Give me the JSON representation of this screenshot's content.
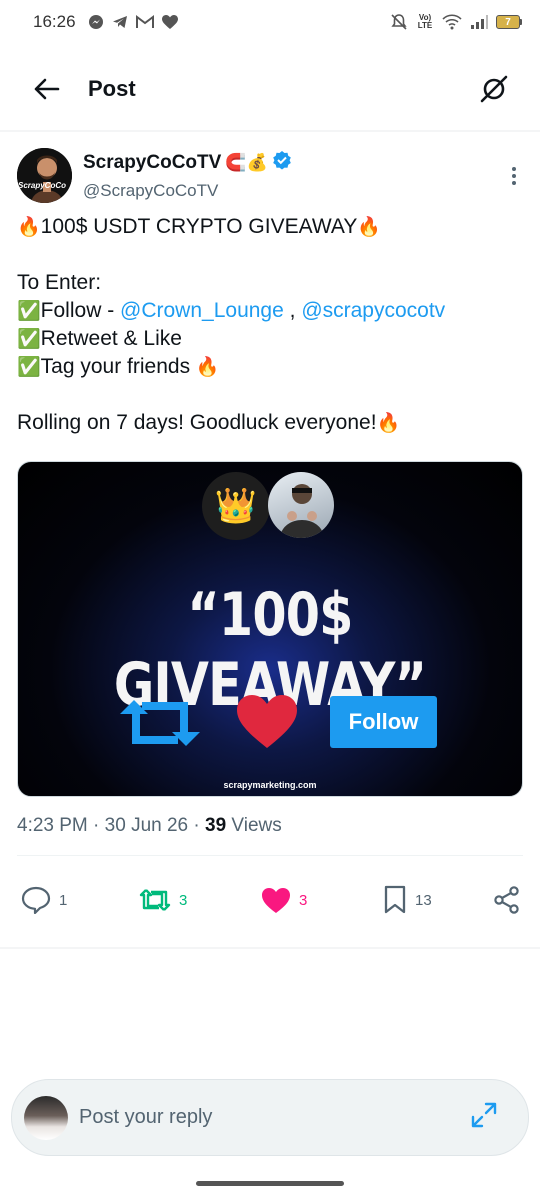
{
  "status_bar": {
    "time": "16:26",
    "network_label": "Vo) LTE",
    "battery_level": "7"
  },
  "header": {
    "title": "Post"
  },
  "author": {
    "name": "ScrapyCoCoTV",
    "name_emojis": "🧲💰",
    "handle": "@ScrapyCoCoTV",
    "avatar_text": "ScrapyCoCo"
  },
  "tweet": {
    "headline_prefix": "🔥",
    "headline": "100$ USDT CRYPTO GIVEAWAY",
    "headline_suffix": "🔥",
    "to_enter": "To Enter:",
    "step1_icon": "✅",
    "step1_text": "Follow - ",
    "mention1": "@Crown_Lounge",
    "separator": " , ",
    "mention2": "@scrapycocotv",
    "step2_icon": "✅",
    "step2_text": "Retweet & Like",
    "step3_icon": "✅",
    "step3_text": "Tag your friends ",
    "step3_emoji": "🔥",
    "closing": "Rolling on 7 days! Goodluck everyone!",
    "closing_emoji": "🔥"
  },
  "media": {
    "title": "“100$ GIVEAWAY”",
    "follow_button": "Follow",
    "site": "scrapymarketing.com",
    "crown_emoji": "👑"
  },
  "meta": {
    "time": "4:23 PM",
    "dot1": " · ",
    "date": "30 Jun 26",
    "dot2": " · ",
    "views_count": "39",
    "views_label": " Views"
  },
  "actions": {
    "replies": "1",
    "retweets": "3",
    "likes": "3",
    "bookmarks": "13"
  },
  "reply_bar": {
    "placeholder": "Post your reply"
  },
  "colors": {
    "accent": "#1d9bf0",
    "retweet": "#00ba7c",
    "like": "#f91880",
    "text_secondary": "#536471"
  }
}
